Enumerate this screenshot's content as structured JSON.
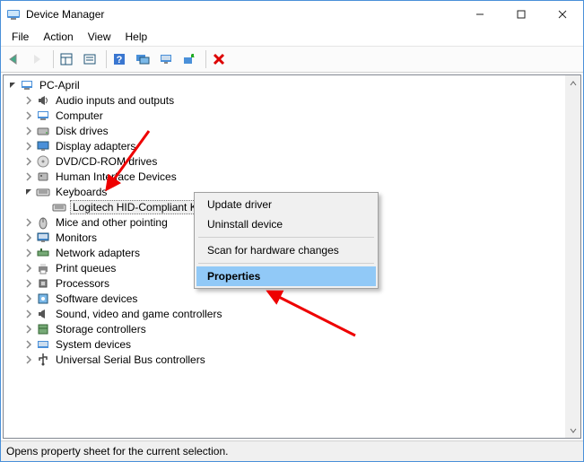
{
  "window": {
    "title": "Device Manager"
  },
  "menubar": [
    "File",
    "Action",
    "View",
    "Help"
  ],
  "tree": {
    "root": "PC-April",
    "categories": [
      {
        "key": "audio",
        "label": "Audio inputs and outputs",
        "icon": "speaker"
      },
      {
        "key": "computer",
        "label": "Computer",
        "icon": "pc"
      },
      {
        "key": "disk",
        "label": "Disk drives",
        "icon": "disk"
      },
      {
        "key": "display",
        "label": "Display adapters",
        "icon": "display"
      },
      {
        "key": "dvd",
        "label": "DVD/CD-ROM drives",
        "icon": "disc"
      },
      {
        "key": "hid",
        "label": "Human Interface Devices",
        "icon": "hid"
      },
      {
        "key": "kbd",
        "label": "Keyboards",
        "expanded": true,
        "icon": "keyboard",
        "children": [
          {
            "key": "kbd0",
            "label": "Logitech  HID-Compliant Keyboard",
            "icon": "keyboard"
          }
        ]
      },
      {
        "key": "mice",
        "label": "Mice and other pointing",
        "icon": "mouse"
      },
      {
        "key": "monitor",
        "label": "Monitors",
        "icon": "monitor"
      },
      {
        "key": "net",
        "label": "Network adapters",
        "icon": "network"
      },
      {
        "key": "print",
        "label": "Print queues",
        "icon": "printer"
      },
      {
        "key": "proc",
        "label": "Processors",
        "icon": "cpu"
      },
      {
        "key": "sw",
        "label": "Software devices",
        "icon": "software"
      },
      {
        "key": "sound",
        "label": "Sound, video and game controllers",
        "icon": "sound"
      },
      {
        "key": "storage",
        "label": "Storage controllers",
        "icon": "storage"
      },
      {
        "key": "system",
        "label": "System devices",
        "icon": "system"
      },
      {
        "key": "usb",
        "label": "Universal Serial Bus controllers",
        "icon": "usb"
      }
    ]
  },
  "context_menu": {
    "items": [
      {
        "label": "Update driver"
      },
      {
        "label": "Uninstall device"
      },
      {
        "sep": true
      },
      {
        "label": "Scan for hardware changes"
      },
      {
        "sep": true
      },
      {
        "label": "Properties",
        "highlight": true
      }
    ]
  },
  "statusbar": "Opens property sheet for the current selection.",
  "toolbar_buttons": [
    "back",
    "forward",
    "sep",
    "show-panel",
    "properties",
    "sep",
    "help",
    "monitors",
    "computers",
    "install",
    "sep",
    "delete"
  ]
}
